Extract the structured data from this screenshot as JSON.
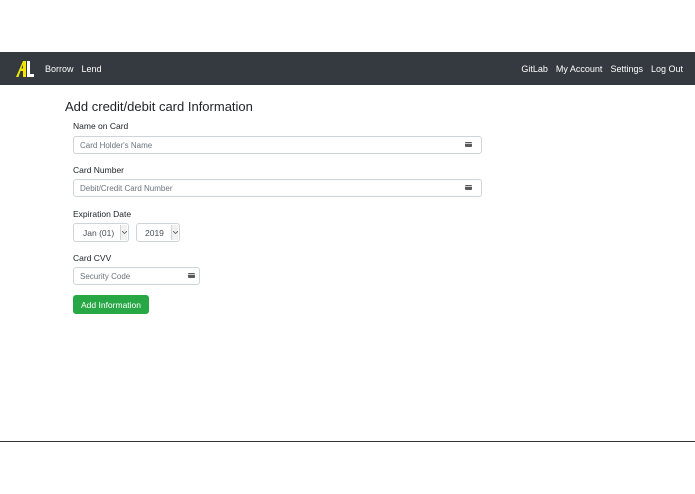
{
  "navbar": {
    "left_links": [
      "Borrow",
      "Lend"
    ],
    "right_links": [
      "GitLab",
      "My Account",
      "Settings",
      "Log Out"
    ],
    "background": "#343a40",
    "logo_icon": "al-logo-icon"
  },
  "page": {
    "title": "Add credit/debit card Information"
  },
  "form": {
    "name_label": "Name on Card",
    "name_placeholder": "Card Holder's Name",
    "number_label": "Card Number",
    "number_placeholder": "Debit/Credit Card Number",
    "expiry_label": "Expiration Date",
    "expiry_month": "Jan (01)",
    "expiry_year": "2019",
    "cvv_label": "Card CVV",
    "cvv_placeholder": "Security Code",
    "submit_label": "Add Information",
    "submit_color": "#28a745",
    "field_icon": "credit-card-icon"
  }
}
